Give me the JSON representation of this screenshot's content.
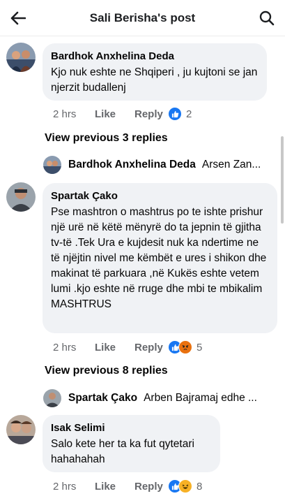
{
  "header": {
    "title": "Sali Berisha's post"
  },
  "comments": [
    {
      "author": "Bardhok Anxhelina Deda",
      "text": "Kjo nuk eshte ne Shqiperi , ju kujtoni se jan njerzit budallenj",
      "time": "2 hrs",
      "like_label": "Like",
      "reply_label": "Reply",
      "reaction_count": "2",
      "reactions": [
        "like"
      ],
      "view_previous": "View previous 3 replies",
      "preview_author": "Bardhok Anxhelina Deda",
      "preview_text": "Arsen Zan..."
    },
    {
      "author": "Spartak Çako",
      "text": "Pse mashtron o mashtrus po te ishte prishur një urë në këtë mënyrë do ta jepnin të gjitha tv-të .Tek Ura e kujdesit nuk ka ndertime ne të njëjtin nivel me këmbët e ures i shikon dhe makinat të parkuara ,në Kukës eshte vetem lumi .kjo eshte në rruge dhe mbi te mbikalim MASHTRUS",
      "time": "2 hrs",
      "like_label": "Like",
      "reply_label": "Reply",
      "reaction_count": "5",
      "reactions": [
        "like",
        "angry"
      ],
      "view_previous": "View previous 8 replies",
      "preview_author": "Spartak Çako",
      "preview_text": "Arben Bajramaj edhe ..."
    },
    {
      "author": "Isak Selimi",
      "text": "Salo kete her ta ka fut qytetari hahahahah",
      "time": "2 hrs",
      "like_label": "Like",
      "reply_label": "Reply",
      "reaction_count": "8",
      "reactions": [
        "like",
        "haha"
      ]
    }
  ],
  "colors": {
    "like": "#1877f2",
    "angry": "#e9710f",
    "haha": "#f7b125",
    "bubble": "#f0f2f5",
    "meta": "#65676b"
  }
}
